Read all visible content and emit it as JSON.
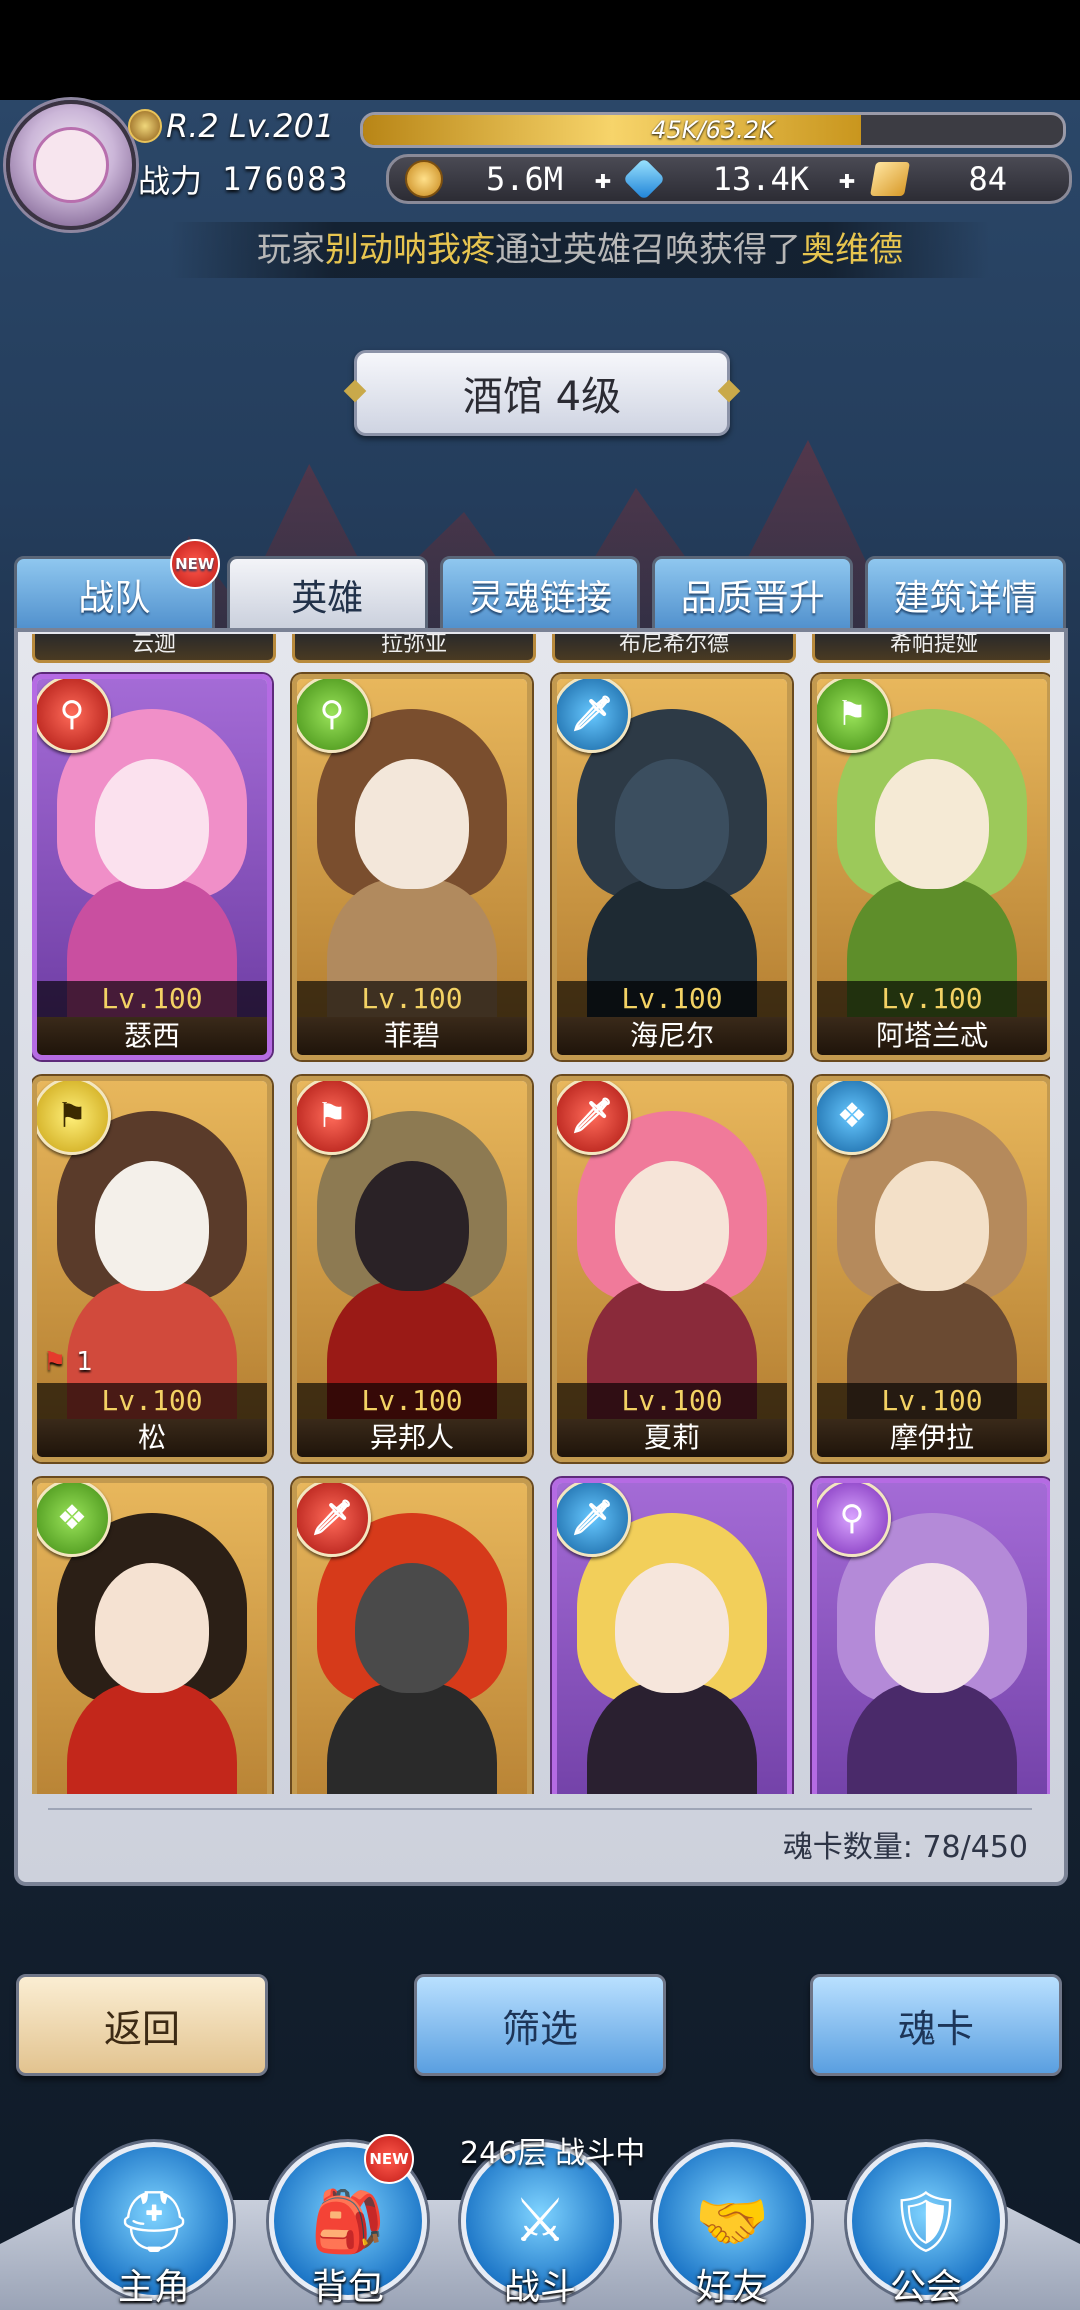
{
  "header": {
    "rank": "R.2 Lv.201",
    "exp": {
      "label": "45K/63.2K",
      "fraction": 0.712
    },
    "power_label": "战力",
    "power_value": "176083",
    "coins": "5.6M",
    "gems": "13.4K",
    "cards": "84"
  },
  "broadcast": {
    "prefix": "玩家",
    "player": "别动呐我疼",
    "middle": "通过英雄召唤获得了",
    "hero": "奥维德"
  },
  "title": "酒馆 4级",
  "tabs": [
    {
      "label": "战队",
      "badge": "NEW"
    },
    {
      "label": "英雄"
    },
    {
      "label": "灵魂链接"
    },
    {
      "label": "品质晋升"
    },
    {
      "label": "建筑详情"
    }
  ],
  "partial_names": [
    "云迦",
    "拉弥亚",
    "布尼希尔德",
    "希帕提娅"
  ],
  "heroes": [
    {
      "name": "瑟西",
      "level": "Lv.100",
      "class_icon": "magnifier-icon",
      "class_color": "#c3201a",
      "rare": true
    },
    {
      "name": "菲碧",
      "level": "Lv.100",
      "class_icon": "magnifier-icon",
      "class_color": "#4a9a1c"
    },
    {
      "name": "海尼尔",
      "level": "Lv.100",
      "class_icon": "dagger-icon",
      "class_color": "#1b6fb0"
    },
    {
      "name": "阿塔兰忒",
      "level": "Lv.100",
      "class_icon": "flag-icon",
      "class_color": "#4a9a1c"
    },
    {
      "name": "松",
      "level": "Lv.100",
      "class_icon": "flag-icon",
      "class_color": "#d4b015",
      "star_count": "1"
    },
    {
      "name": "异邦人",
      "level": "Lv.100",
      "class_icon": "flag-icon",
      "class_color": "#c3201a"
    },
    {
      "name": "夏莉",
      "level": "Lv.100",
      "class_icon": "dagger-icon",
      "class_color": "#c3201a"
    },
    {
      "name": "摩伊拉",
      "level": "Lv.100",
      "class_icon": "wings-icon",
      "class_color": "#1b6fb0"
    },
    {
      "name": "",
      "level": "",
      "class_icon": "wings-icon",
      "class_color": "#4a9a1c"
    },
    {
      "name": "",
      "level": "",
      "class_icon": "dagger-icon",
      "class_color": "#c3201a"
    },
    {
      "name": "",
      "level": "",
      "class_icon": "dagger-icon",
      "class_color": "#1b6fb0",
      "rare": true
    },
    {
      "name": "",
      "level": "",
      "class_icon": "magnifier-icon",
      "class_color": "#8b3bc7",
      "rare": true
    }
  ],
  "card_count": "魂卡数量: 78/450",
  "buttons": {
    "back": "返回",
    "filter": "筛选",
    "soul_card": "魂卡"
  },
  "battle_status": {
    "floor": "246层",
    "state": "战斗中"
  },
  "nav": [
    {
      "label": "主角",
      "icon": "helmet-icon"
    },
    {
      "label": "背包",
      "icon": "backpack-icon",
      "badge": "NEW"
    },
    {
      "label": "战斗",
      "icon": "swords-icon"
    },
    {
      "label": "好友",
      "icon": "handshake-icon"
    },
    {
      "label": "公会",
      "icon": "guild-emblem-icon"
    }
  ]
}
